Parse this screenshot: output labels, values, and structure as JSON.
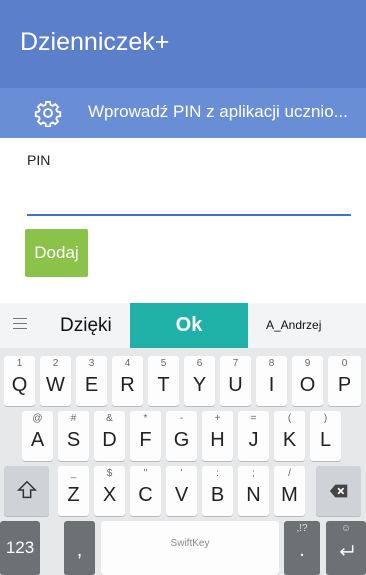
{
  "app": {
    "title": "Dzienniczek+"
  },
  "pin_banner": {
    "icon": "gear-icon",
    "text": "Wprowadź PIN z aplikacji ucznio..."
  },
  "form": {
    "pin_label": "PIN",
    "pin_value": "",
    "add_label": "Dodaj"
  },
  "keyboard": {
    "suggestions": [
      "Dzięki",
      "Ok",
      "A_Andrzej"
    ],
    "row1": [
      {
        "hint": "1",
        "key": "Q"
      },
      {
        "hint": "2",
        "key": "W"
      },
      {
        "hint": "3",
        "key": "E"
      },
      {
        "hint": "4",
        "key": "R"
      },
      {
        "hint": "5",
        "key": "T"
      },
      {
        "hint": "6",
        "key": "Y"
      },
      {
        "hint": "7",
        "key": "U"
      },
      {
        "hint": "8",
        "key": "I"
      },
      {
        "hint": "9",
        "key": "O"
      },
      {
        "hint": "0",
        "key": "P"
      }
    ],
    "row2": [
      {
        "hint": "@",
        "key": "A"
      },
      {
        "hint": "#",
        "key": "S"
      },
      {
        "hint": "&",
        "key": "D"
      },
      {
        "hint": "*",
        "key": "F"
      },
      {
        "hint": "-",
        "key": "G"
      },
      {
        "hint": "+",
        "key": "H"
      },
      {
        "hint": "=",
        "key": "J"
      },
      {
        "hint": "(",
        "key": "K"
      },
      {
        "hint": ")",
        "key": "L"
      }
    ],
    "row3": [
      {
        "hint": "_",
        "key": "Z"
      },
      {
        "hint": "$",
        "key": "X"
      },
      {
        "hint": "\"",
        "key": "C"
      },
      {
        "hint": "'",
        "key": "V"
      },
      {
        "hint": ":",
        "key": "B"
      },
      {
        "hint": ";",
        "key": "N"
      },
      {
        "hint": "/",
        "key": "M"
      }
    ],
    "row4": {
      "numbers": "123",
      "comma": ",",
      "space": "SwiftKey",
      "punct_hint": ",!?",
      "punct": ".",
      "enter_hint": "☺"
    }
  }
}
